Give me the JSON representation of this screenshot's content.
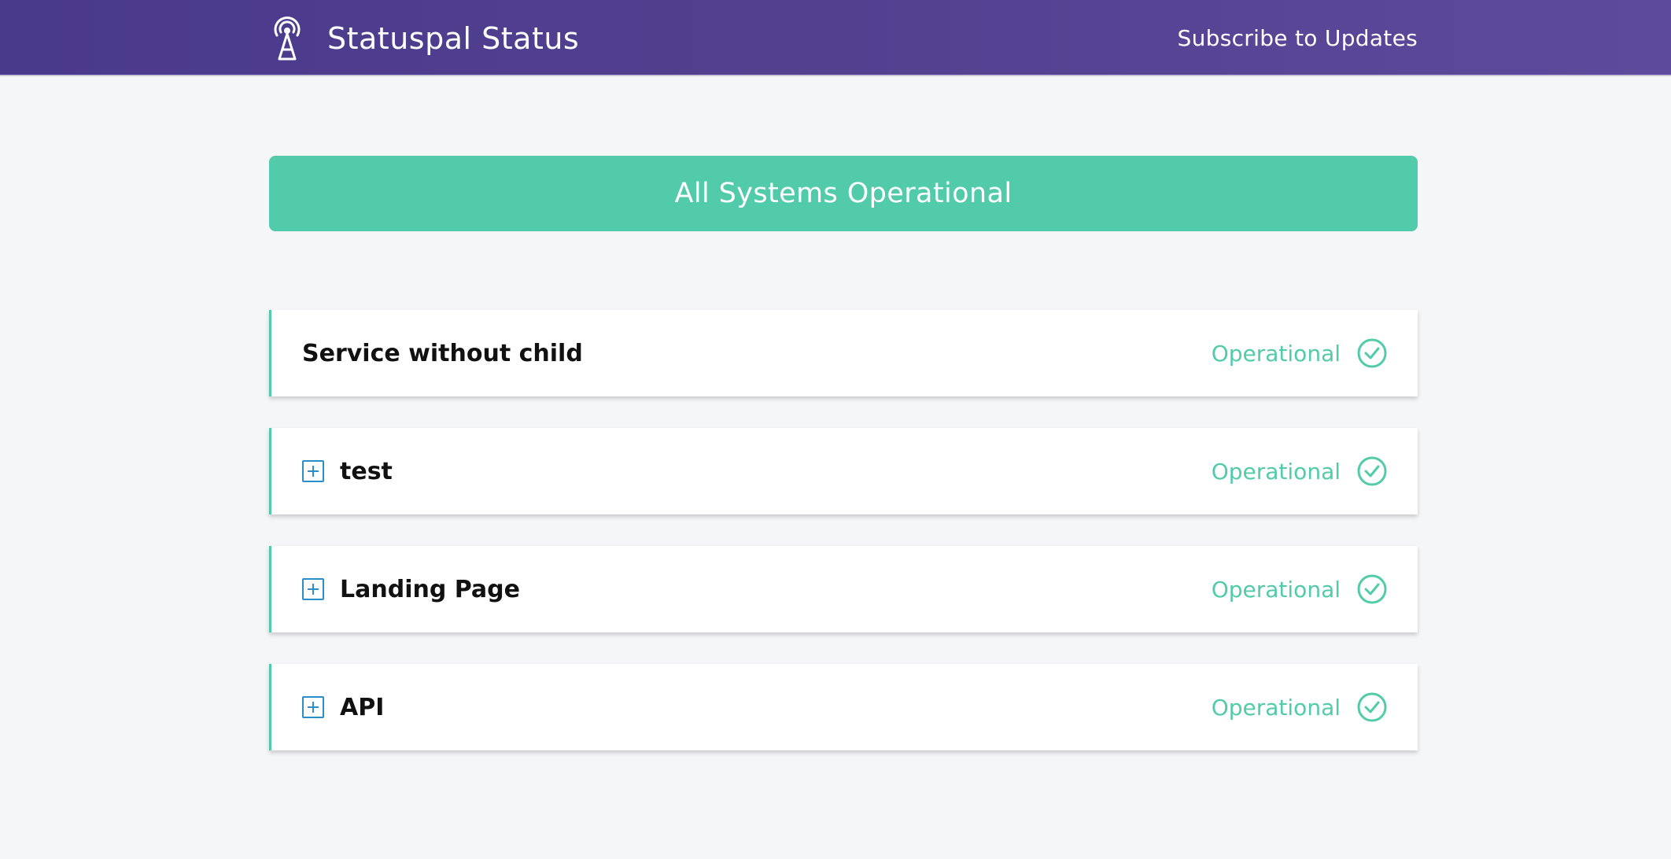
{
  "header": {
    "title": "Statuspal Status",
    "subscribe_label": "Subscribe to Updates",
    "logo_icon": "antenna-tower-icon"
  },
  "banner": {
    "text": "All Systems Operational",
    "color": "#51cba9"
  },
  "colors": {
    "header_gradient_start": "#4a3a8c",
    "header_gradient_end": "#5e4a9c",
    "operational": "#51cba9",
    "expand_icon": "#2b8fc7",
    "page_background": "#f5f6f8"
  },
  "services": [
    {
      "name": "Service without child",
      "status": "Operational",
      "expandable": false,
      "status_icon": "check-circle-icon"
    },
    {
      "name": "test",
      "status": "Operational",
      "expandable": true,
      "expand_icon": "plus-square-icon",
      "status_icon": "check-circle-icon"
    },
    {
      "name": "Landing Page",
      "status": "Operational",
      "expandable": true,
      "expand_icon": "plus-square-icon",
      "status_icon": "check-circle-icon"
    },
    {
      "name": "API",
      "status": "Operational",
      "expandable": true,
      "expand_icon": "plus-square-icon",
      "status_icon": "check-circle-icon"
    }
  ]
}
